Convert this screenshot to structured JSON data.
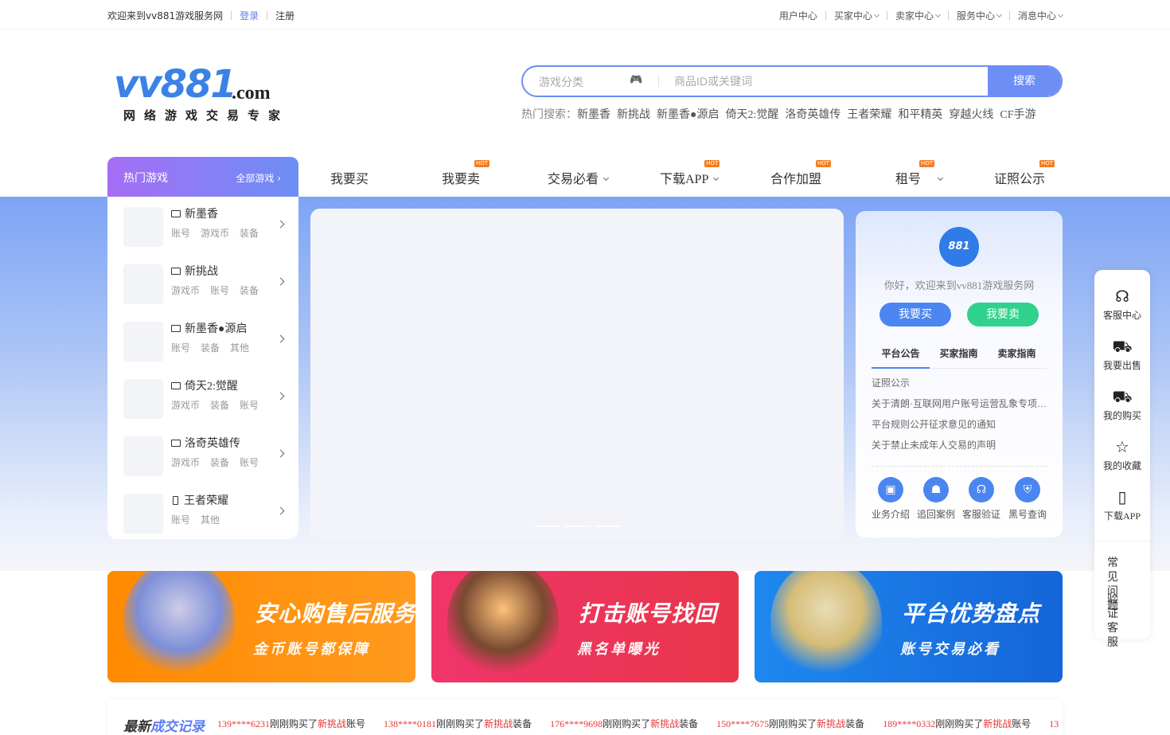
{
  "topbar": {
    "welcome": "欢迎来到vv881游戏服务网",
    "login": "登录",
    "register": "注册",
    "links": [
      "用户中心",
      "买家中心",
      "卖家中心",
      "服务中心",
      "消息中心"
    ]
  },
  "logo": {
    "main": "vv881",
    "suffix": ".com",
    "slogan": "网络游戏交易专家"
  },
  "search": {
    "category_placeholder": "游戏分类",
    "keyword_placeholder": "商品ID或关键词",
    "button": "搜索",
    "hot_label": "热门搜索：",
    "hot_keywords": [
      "新墨香",
      "新挑战",
      "新墨香●源启",
      "倚天2:觉醒",
      "洛奇英雄传",
      "王者荣耀",
      "和平精英",
      "穿越火线",
      "CF手游"
    ]
  },
  "nav": {
    "hot_games_title": "热门游戏",
    "all_games": "全部游戏 ›",
    "hot_badge": "HOT",
    "items": [
      "我要买",
      "我要卖",
      "交易必看",
      "下载APP",
      "合作加盟",
      "租号",
      "证照公示"
    ]
  },
  "games": [
    {
      "name": "新墨香",
      "tags": "账号 游戏币 装备",
      "device": "pc"
    },
    {
      "name": "新挑战",
      "tags": "游戏币 账号 装备",
      "device": "pc"
    },
    {
      "name": "新墨香●源启",
      "tags": "账号 装备 其他",
      "device": "pc"
    },
    {
      "name": "倚天2:觉醒",
      "tags": "游戏币 装备 账号",
      "device": "pc"
    },
    {
      "name": "洛奇英雄传",
      "tags": "游戏币 装备 账号",
      "device": "pc"
    },
    {
      "name": "王者荣耀",
      "tags": "账号 其他",
      "device": "mobile"
    }
  ],
  "userpanel": {
    "avatar_text": "881",
    "welcome": "你好，欢迎来到vv881游戏服务网",
    "buy": "我要买",
    "sell": "我要卖",
    "tabs": [
      "平台公告",
      "买家指南",
      "卖家指南"
    ],
    "notices": [
      "证照公示",
      "关于清朗·互联网用户账号运营乱象专项行动",
      "平台规则公开征求意见的通知",
      "关于禁止未成年人交易的声明"
    ],
    "services": [
      "业务介绍",
      "追回案例",
      "客服验证",
      "黑号查询"
    ]
  },
  "floatbar": {
    "items": [
      "客服中心",
      "我要出售",
      "我的购买",
      "我的收藏",
      "下载APP"
    ],
    "faq": "常见问题",
    "verify": "验证客服"
  },
  "banners": [
    {
      "title": "安心购售后服务",
      "subtitle": "金币账号都保障",
      "color_from": "#ff8a00",
      "color_to": "#ff9a1f"
    },
    {
      "title": "打击账号找回",
      "subtitle": "黑名单曝光",
      "color_from": "#f0356b",
      "color_to": "#e9354a"
    },
    {
      "title": "平台优势盘点",
      "subtitle": "账号交易必看",
      "color_from": "#1e88f0",
      "color_to": "#1565d8"
    }
  ],
  "deals": {
    "title_a": "最新",
    "title_b": "成交记录",
    "action": "刚刚购买了",
    "records": [
      {
        "phone": "139****6231",
        "game": "新挑战",
        "item": "账号"
      },
      {
        "phone": "138****0181",
        "game": "新挑战",
        "item": "装备"
      },
      {
        "phone": "176****9698",
        "game": "新挑战",
        "item": "装备"
      },
      {
        "phone": "150****7675",
        "game": "新挑战",
        "item": "装备"
      },
      {
        "phone": "189****0332",
        "game": "新挑战",
        "item": "账号"
      }
    ],
    "overflow": "13"
  }
}
